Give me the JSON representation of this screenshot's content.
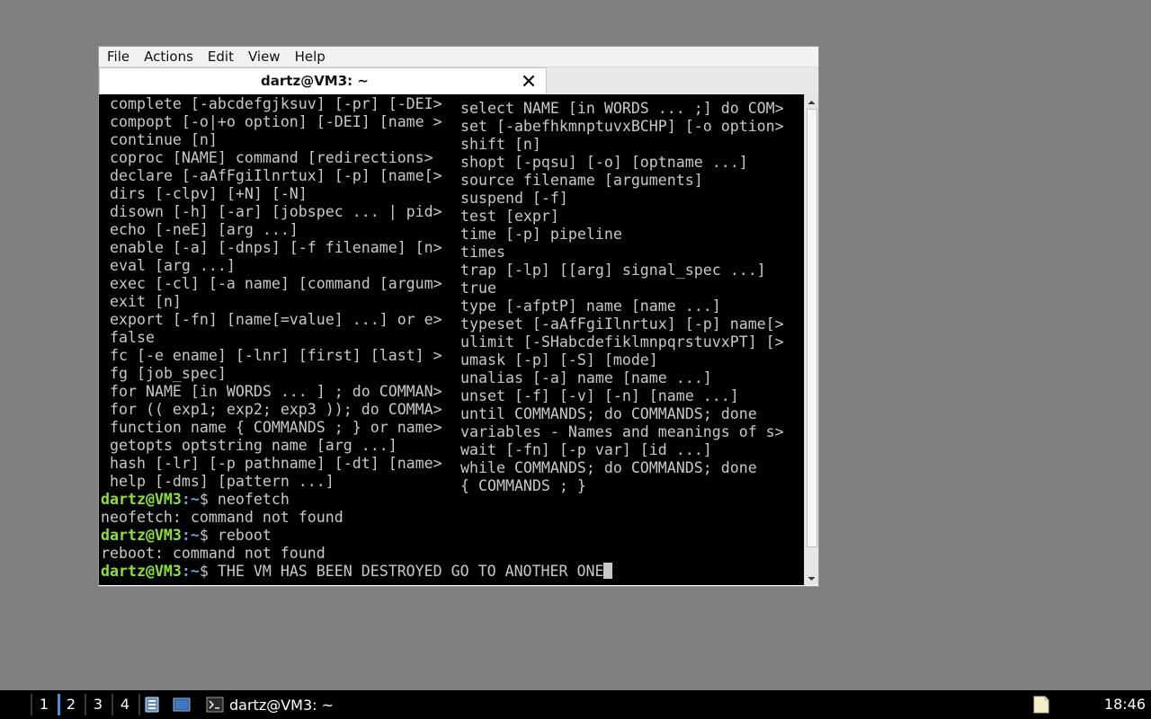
{
  "window": {
    "menu": [
      "File",
      "Actions",
      "Edit",
      "View",
      "Help"
    ],
    "tab_title": "dartz@VM3: ~",
    "close_icon": "close-icon"
  },
  "terminal": {
    "help_rows": [
      [
        "complete [-abcdefgjksuv] [-pr] [-DEI>",
        "select NAME [in WORDS ... ;] do COM>"
      ],
      [
        "compopt [-o|+o option] [-DEI] [name >",
        "set [-abefhkmnptuvxBCHP] [-o option>"
      ],
      [
        "continue [n]",
        "shift [n]"
      ],
      [
        "coproc [NAME] command [redirections>",
        "shopt [-pqsu] [-o] [optname ...]"
      ],
      [
        "declare [-aAfFgiIlnrtux] [-p] [name[>",
        "source filename [arguments]"
      ],
      [
        "dirs [-clpv] [+N] [-N]",
        "suspend [-f]"
      ],
      [
        "disown [-h] [-ar] [jobspec ... | pid>",
        "test [expr]"
      ],
      [
        "echo [-neE] [arg ...]",
        "time [-p] pipeline"
      ],
      [
        "enable [-a] [-dnps] [-f filename] [n>",
        "times"
      ],
      [
        "eval [arg ...]",
        "trap [-lp] [[arg] signal_spec ...]"
      ],
      [
        "exec [-cl] [-a name] [command [argum>",
        "true"
      ],
      [
        "exit [n]",
        "type [-afptP] name [name ...]"
      ],
      [
        "export [-fn] [name[=value] ...] or e>",
        "typeset [-aAfFgiIlnrtux] [-p] name[>"
      ],
      [
        "false",
        "ulimit [-SHabcdefiklmnpqrstuvxPT] [>"
      ],
      [
        "fc [-e ename] [-lnr] [first] [last] >",
        "umask [-p] [-S] [mode]"
      ],
      [
        "fg [job_spec]",
        "unalias [-a] name [name ...]"
      ],
      [
        "for NAME [in WORDS ... ] ; do COMMAN>",
        "unset [-f] [-v] [-n] [name ...]"
      ],
      [
        "for (( exp1; exp2; exp3 )); do COMMA>",
        "until COMMANDS; do COMMANDS; done"
      ],
      [
        "function name { COMMANDS ; } or name>",
        "variables - Names and meanings of s>"
      ],
      [
        "getopts optstring name [arg ...]",
        "wait [-fn] [-p var] [id ...]"
      ],
      [
        "hash [-lr] [-p pathname] [-dt] [name>",
        "while COMMANDS; do COMMANDS; done"
      ],
      [
        "help [-dms] [pattern ...]",
        "{ COMMANDS ; }"
      ]
    ],
    "prompt_user": "dartz@VM3",
    "prompt_path": ":~",
    "prompt_sign": "$ ",
    "cmd1": "neofetch",
    "out1": "neofetch: command not found",
    "cmd2": "reboot",
    "out2": "reboot: command not found",
    "cmd3": "THE VM HAS BEEN DESTROYED GO TO ANOTHER ONE"
  },
  "taskbar": {
    "workspaces": [
      "1",
      "2",
      "3",
      "4"
    ],
    "active_workspace": "2",
    "task_label": "dartz@VM3: ~",
    "clock": "18:46",
    "icons": {
      "files": "file-manager-icon",
      "terminal_launcher": "terminal-launcher-icon",
      "task": "terminal-icon",
      "tray": "notes-icon"
    },
    "active_color": "#4a90d9"
  },
  "colors": {
    "desktop": "#808080",
    "terminal_bg": "#000000",
    "terminal_fg": "#c8c8c8",
    "prompt_user": "#8ae234",
    "prompt_path": "#729fcf"
  }
}
